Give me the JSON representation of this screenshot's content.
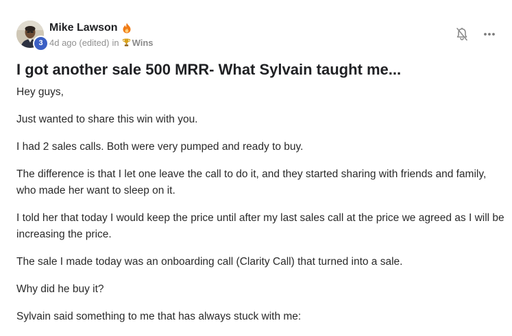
{
  "author": {
    "name": "Mike Lawson",
    "level": "3",
    "avatar_icon": "user-avatar-photo",
    "flame_icon": "flame-icon"
  },
  "meta": {
    "time": "4d ago (edited)",
    "in_label": "in",
    "category": "Wins",
    "category_icon": "trophy-icon"
  },
  "actions": {
    "bell_icon": "bell-muted-icon",
    "more_icon": "more-horizontal-icon"
  },
  "post": {
    "title": "I got another sale 500 MRR- What Sylvain taught me...",
    "paragraphs": [
      "Hey guys,",
      "Just wanted to share this win with you.",
      "I had 2 sales calls. Both were very pumped and ready to buy.",
      "The difference is that I let one leave the call to do it, and they started sharing with friends and family, who made her want to sleep on it.",
      "I told her that today I would keep the price until after my last sales call at the price we agreed as I will be increasing the price.",
      "The sale I made today was an onboarding call (Clarity Call) that turned into a sale.",
      "Why did he buy it?",
      "Sylvain said something to me that has always stuck with me:"
    ]
  },
  "colors": {
    "level_badge": "#3b5fc4",
    "flame": "#f07b16",
    "trophy": "#d9a21b",
    "meta_text": "#909090"
  }
}
